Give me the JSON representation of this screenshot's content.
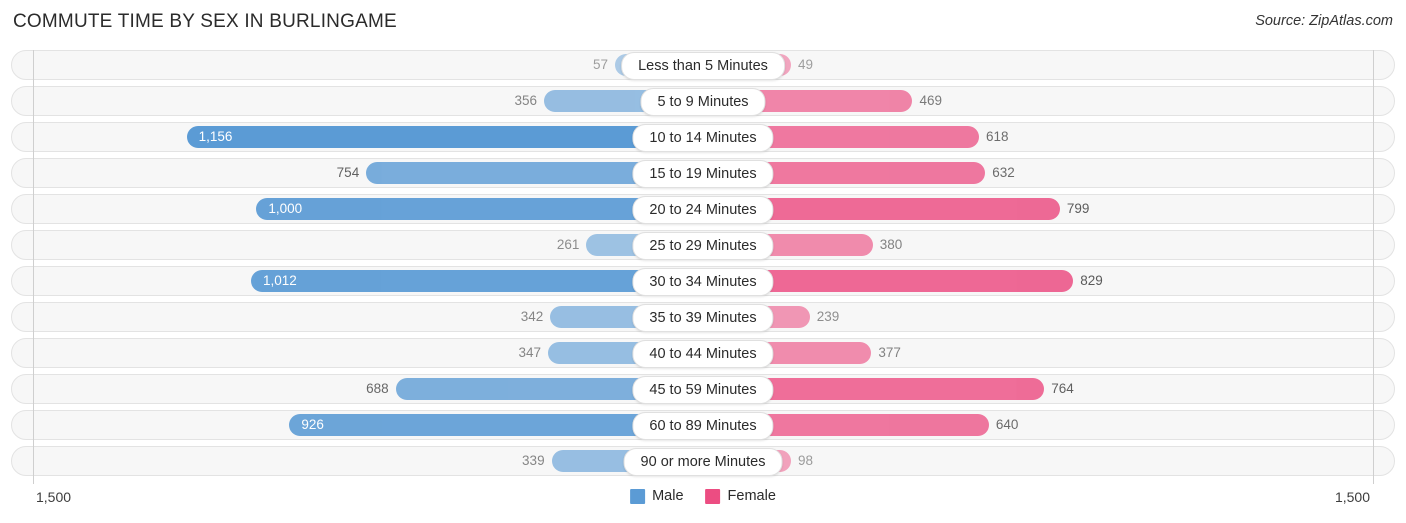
{
  "header": {
    "title": "COMMUTE TIME BY SEX IN BURLINGAME",
    "source": "Source: ZipAtlas.com"
  },
  "axis": {
    "left_label": "1,500",
    "right_label": "1,500",
    "max": 1500
  },
  "legend": {
    "items": [
      {
        "label": "Male",
        "color": "#5b9bd5"
      },
      {
        "label": "Female",
        "color": "#ec4d82"
      }
    ]
  },
  "chart_data": {
    "type": "bar",
    "title": "COMMUTE TIME BY SEX IN BURLINGAME",
    "subtitle": "Source: ZipAtlas.com",
    "orientation": "horizontal-diverging",
    "xlabel": "",
    "ylabel": "",
    "xlim": [
      -1500,
      1500
    ],
    "axis_tick_labels": [
      "1,500",
      "1,500"
    ],
    "grid": false,
    "legend_position": "bottom-center",
    "categories": [
      "Less than 5 Minutes",
      "5 to 9 Minutes",
      "10 to 14 Minutes",
      "15 to 19 Minutes",
      "20 to 24 Minutes",
      "25 to 29 Minutes",
      "30 to 34 Minutes",
      "35 to 39 Minutes",
      "40 to 44 Minutes",
      "45 to 59 Minutes",
      "60 to 89 Minutes",
      "90 or more Minutes"
    ],
    "series": [
      {
        "name": "Male",
        "color": "#5b9bd5",
        "values": [
          57,
          356,
          1156,
          754,
          1000,
          261,
          1012,
          342,
          347,
          688,
          926,
          339
        ],
        "labels": [
          "57",
          "356",
          "1,156",
          "754",
          "1,000",
          "261",
          "1,012",
          "342",
          "347",
          "688",
          "926",
          "339"
        ]
      },
      {
        "name": "Female",
        "color": "#ec4d82",
        "values": [
          49,
          469,
          618,
          632,
          799,
          380,
          829,
          239,
          377,
          764,
          640,
          98
        ],
        "labels": [
          "49",
          "469",
          "618",
          "632",
          "799",
          "380",
          "829",
          "239",
          "377",
          "764",
          "640",
          "98"
        ]
      }
    ]
  }
}
